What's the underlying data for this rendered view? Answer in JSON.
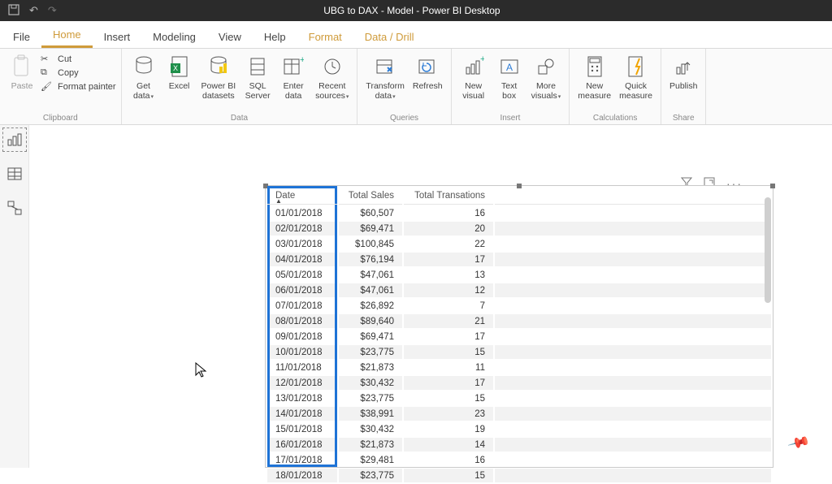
{
  "app": {
    "title": "UBG to DAX - Model - Power BI Desktop"
  },
  "menu": {
    "file": "File",
    "home": "Home",
    "insert": "Insert",
    "modeling": "Modeling",
    "view": "View",
    "help": "Help",
    "format": "Format",
    "datadrill": "Data / Drill"
  },
  "ribbon": {
    "clipboard": {
      "label": "Clipboard",
      "paste": "Paste",
      "cut": "Cut",
      "copy": "Copy",
      "fmt": "Format painter"
    },
    "data": {
      "label": "Data",
      "getdata": "Get\ndata",
      "excel": "Excel",
      "pbids": "Power BI\ndatasets",
      "sql": "SQL\nServer",
      "enter": "Enter\ndata",
      "recent": "Recent\nsources"
    },
    "queries": {
      "label": "Queries",
      "transform": "Transform\ndata",
      "refresh": "Refresh"
    },
    "insert": {
      "label": "Insert",
      "newvisual": "New\nvisual",
      "textbox": "Text\nbox",
      "morevisuals": "More\nvisuals"
    },
    "calc": {
      "label": "Calculations",
      "newmeasure": "New\nmeasure",
      "quick": "Quick\nmeasure"
    },
    "share": {
      "label": "Share",
      "publish": "Publish"
    }
  },
  "table": {
    "headers": {
      "date": "Date",
      "sales": "Total Sales",
      "trans": "Total Transations"
    },
    "rows": [
      {
        "d": "01/01/2018",
        "s": "$60,507",
        "t": "16"
      },
      {
        "d": "02/01/2018",
        "s": "$69,471",
        "t": "20"
      },
      {
        "d": "03/01/2018",
        "s": "$100,845",
        "t": "22"
      },
      {
        "d": "04/01/2018",
        "s": "$76,194",
        "t": "17"
      },
      {
        "d": "05/01/2018",
        "s": "$47,061",
        "t": "13"
      },
      {
        "d": "06/01/2018",
        "s": "$47,061",
        "t": "12"
      },
      {
        "d": "07/01/2018",
        "s": "$26,892",
        "t": "7"
      },
      {
        "d": "08/01/2018",
        "s": "$89,640",
        "t": "21"
      },
      {
        "d": "09/01/2018",
        "s": "$69,471",
        "t": "17"
      },
      {
        "d": "10/01/2018",
        "s": "$23,775",
        "t": "15"
      },
      {
        "d": "11/01/2018",
        "s": "$21,873",
        "t": "11"
      },
      {
        "d": "12/01/2018",
        "s": "$30,432",
        "t": "17"
      },
      {
        "d": "13/01/2018",
        "s": "$23,775",
        "t": "15"
      },
      {
        "d": "14/01/2018",
        "s": "$38,991",
        "t": "23"
      },
      {
        "d": "15/01/2018",
        "s": "$30,432",
        "t": "19"
      },
      {
        "d": "16/01/2018",
        "s": "$21,873",
        "t": "14"
      },
      {
        "d": "17/01/2018",
        "s": "$29,481",
        "t": "16"
      },
      {
        "d": "18/01/2018",
        "s": "$23,775",
        "t": "15"
      }
    ]
  }
}
